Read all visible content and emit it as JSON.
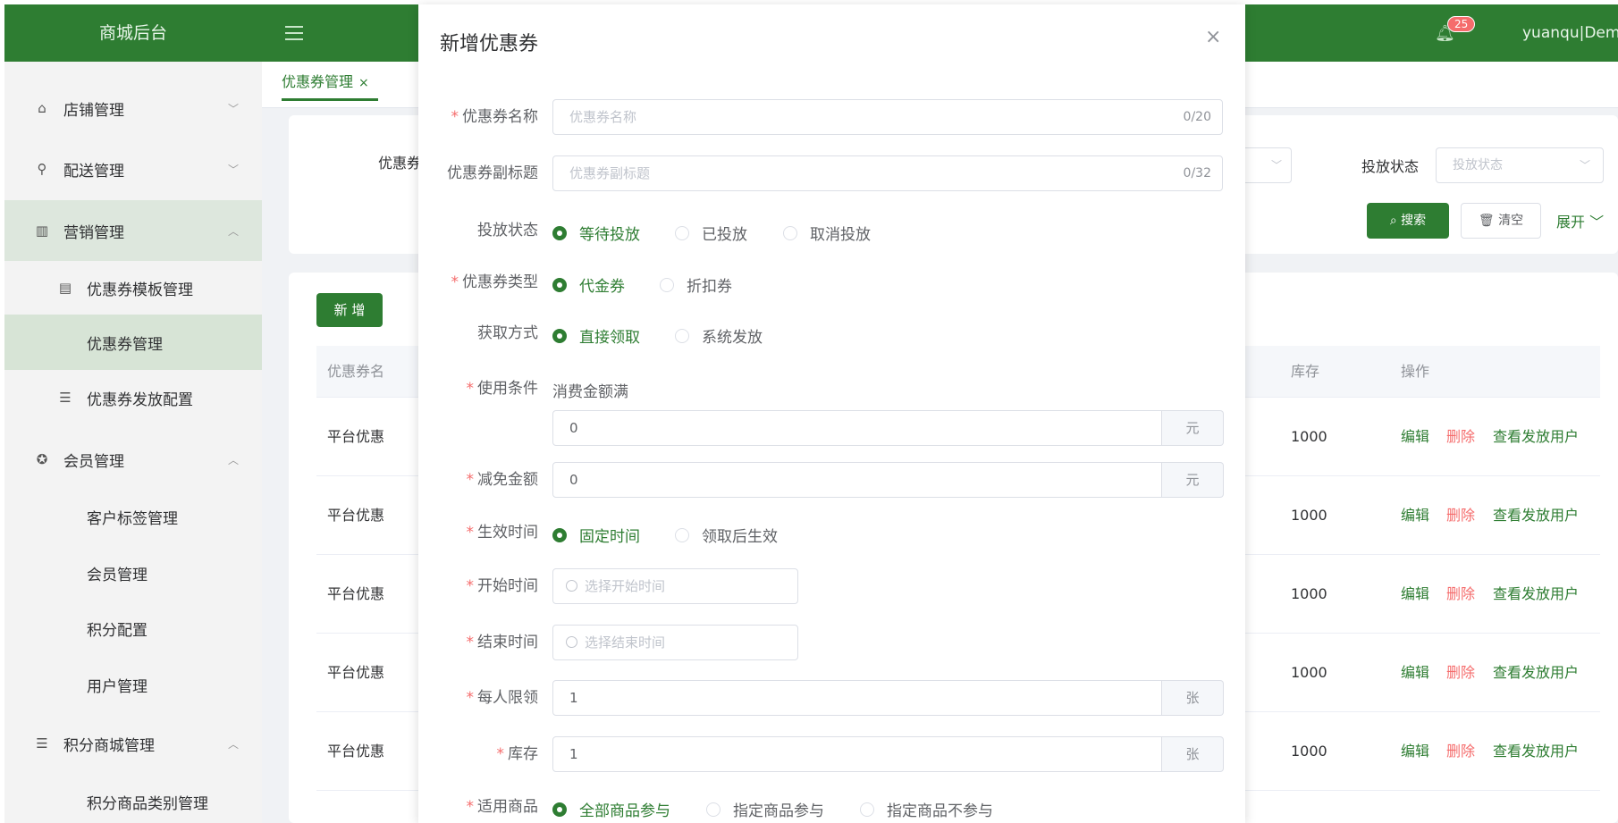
{
  "header": {
    "logo": "商城后台",
    "badge": "25",
    "user": "yuanqu|Demo"
  },
  "sidebar": {
    "items": [
      {
        "icon": "store-icon",
        "glyph": "⌂",
        "label": "店铺管理",
        "chev": "﹀"
      },
      {
        "icon": "location-icon",
        "glyph": "⚲",
        "label": "配送管理",
        "chev": "﹀"
      },
      {
        "icon": "chart-icon",
        "glyph": "▥",
        "label": "营销管理",
        "chev": "︿"
      },
      {
        "icon": "document-icon",
        "glyph": "▤",
        "label": "优惠券模板管理"
      },
      {
        "label": "优惠券管理"
      },
      {
        "icon": "list-icon",
        "glyph": "☰",
        "label": "优惠券发放配置"
      },
      {
        "icon": "badge-icon",
        "glyph": "✪",
        "label": "会员管理",
        "chev": "︿"
      },
      {
        "label": "客户标签管理"
      },
      {
        "label": "会员管理"
      },
      {
        "label": "积分配置"
      },
      {
        "label": "用户管理"
      },
      {
        "icon": "list-icon",
        "glyph": "☰",
        "label": "积分商城管理",
        "chev": "︿"
      },
      {
        "label": "积分商品类别管理"
      }
    ]
  },
  "tabs": {
    "active": "优惠券管理",
    "close": "×"
  },
  "search": {
    "name_label": "优惠券",
    "status_label": "投放状态",
    "status_placeholder": "投放状态",
    "search_btn": "搜索",
    "clear_btn": "清空",
    "expand_btn": "展开"
  },
  "table": {
    "new_btn": "新 增",
    "headers": {
      "name": "优惠券名",
      "stock": "库存",
      "ops": "操作"
    },
    "rows": [
      {
        "name": "平台优惠",
        "stock": "1000"
      },
      {
        "name": "平台优惠",
        "stock": "1000"
      },
      {
        "name": "平台优惠",
        "stock": "1000"
      },
      {
        "name": "平台优惠",
        "stock": "1000"
      },
      {
        "name": "平台优惠",
        "stock": "1000"
      }
    ],
    "actions": {
      "edit": "编辑",
      "del": "删除",
      "view": "查看发放用户"
    }
  },
  "dialog": {
    "title": "新增优惠券",
    "close": "×",
    "fields": {
      "name": {
        "label": "优惠券名称",
        "placeholder": "优惠券名称",
        "count": "0/20"
      },
      "subtitle": {
        "label": "优惠券副标题",
        "placeholder": "优惠券副标题",
        "count": "0/32"
      },
      "status": {
        "label": "投放状态",
        "options": [
          "等待投放",
          "已投放",
          "取消投放"
        ]
      },
      "type": {
        "label": "优惠券类型",
        "options": [
          "代金券",
          "折扣券"
        ]
      },
      "obtain": {
        "label": "获取方式",
        "options": [
          "直接领取",
          "系统发放"
        ]
      },
      "condition": {
        "label": "使用条件",
        "text": "消费金额满",
        "value": "0",
        "unit": "元"
      },
      "discount": {
        "label": "减免金额",
        "value": "0",
        "unit": "元"
      },
      "effective": {
        "label": "生效时间",
        "options": [
          "固定时间",
          "领取后生效"
        ]
      },
      "start": {
        "label": "开始时间",
        "placeholder": "选择开始时间"
      },
      "end": {
        "label": "结束时间",
        "placeholder": "选择结束时间"
      },
      "limit": {
        "label": "每人限领",
        "value": "1",
        "unit": "张"
      },
      "stock": {
        "label": "库存",
        "value": "1",
        "unit": "张"
      },
      "goods": {
        "label": "适用商品",
        "options": [
          "全部商品参与",
          "指定商品参与",
          "指定商品不参与"
        ]
      }
    }
  },
  "colors": {
    "primary": "#2e7d32",
    "danger": "#f56c6c"
  }
}
